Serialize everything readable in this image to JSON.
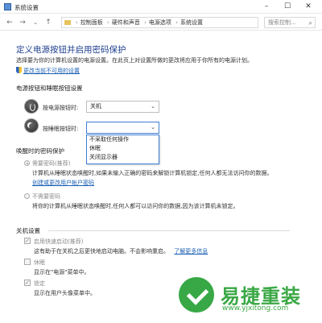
{
  "window": {
    "title": "系统设置"
  },
  "address": {
    "crumbs": [
      "控制面板",
      "硬件和声音",
      "电源选项",
      "系统设置"
    ],
    "search_placeholder": "搜索控制..."
  },
  "page": {
    "heading": "定义电源按钮并启用密码保护",
    "intro": "选择要为你的计算机设置的电源设置。在此页上对设置所做的更改将应用于你所有的电源计划。",
    "change_link": "更改当前不可用的设置",
    "section_buttons": "电源按钮和睡眠按钮设置",
    "power_button_label": "按电源按钮时:",
    "power_button_value": "关机",
    "sleep_button_label": "按睡眠按钮时:",
    "sleep_button_value": "",
    "sleep_options": [
      "不采取任何操作",
      "休眠",
      "关闭显示器"
    ],
    "section_wake": "唤醒时的密码保护",
    "require_password": "需要密码(推荐)",
    "require_desc": "计算机从睡眠状态唤醒时,如果未输入正确的密码来解锁计算机锁定,任何人都无法访问你的数据。",
    "account_link": "创建或更改用户帐户密码",
    "no_password": "不需要密码",
    "no_password_desc": "将你的计算机从睡眠状态唤醒时,任何人都可以访问你的数据,因为该计算机未锁定。",
    "section_shutdown": "关机设置",
    "fast_startup": "启用快速启动(推荐)",
    "fast_startup_desc": "这有助于在关机之后更快地启动电脑。不会影响重启。",
    "learn_more": "了解更多信息",
    "hibernate": "休眠",
    "hibernate_desc": "显示在\"电源\"菜单中。",
    "lock": "锁定",
    "lock_desc": "显示在用户头像菜单中。"
  },
  "watermark": {
    "brand": "易捷重装",
    "url": "www.yjxitong.com"
  }
}
